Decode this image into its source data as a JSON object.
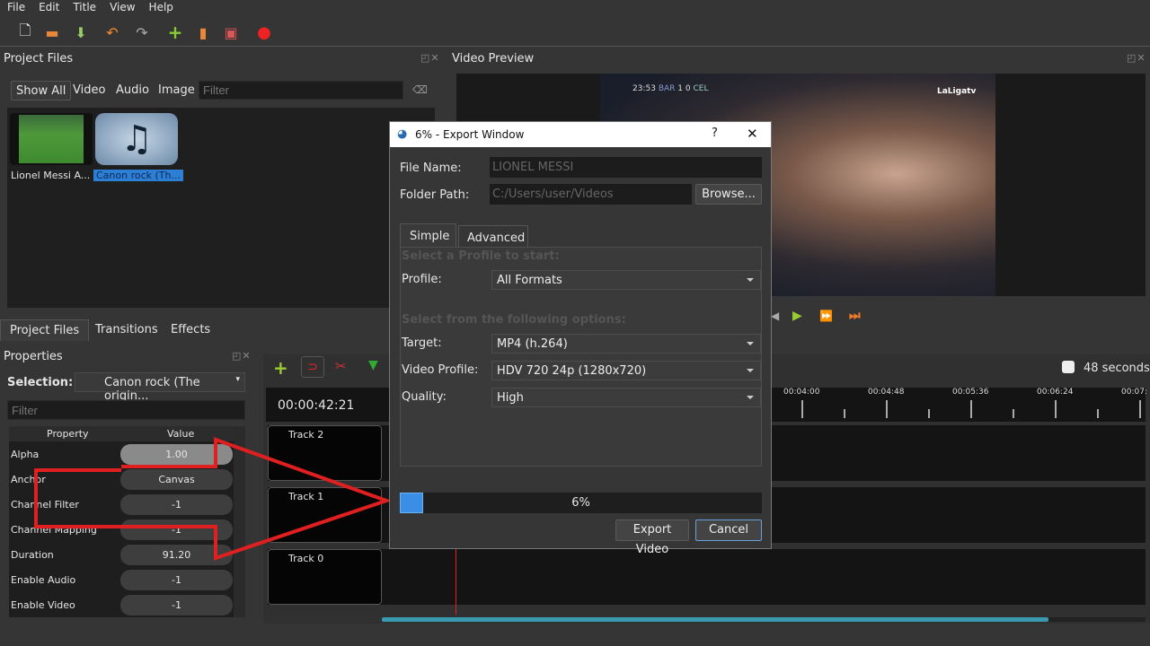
{
  "menu": [
    "File",
    "Edit",
    "Title",
    "View",
    "Help"
  ],
  "toolbar": {
    "icons": [
      "new-project-icon",
      "open-project-icon",
      "save-project-icon",
      "undo-icon",
      "redo-icon",
      "import-files-icon",
      "profile-icon",
      "fullscreen-icon",
      "export-icon"
    ]
  },
  "project_files": {
    "title": "Project Files",
    "filters": [
      "Show All",
      "Video",
      "Audio",
      "Image"
    ],
    "filter_placeholder": "Filter",
    "items": [
      {
        "name": "Lionel Messi A...",
        "type": "video"
      },
      {
        "name": "Canon rock (Th...",
        "type": "audio",
        "selected": true
      }
    ]
  },
  "video_preview": {
    "title": "Video Preview",
    "scoreboard": {
      "time": "23:53",
      "home": "BAR",
      "home_score": "1",
      "away_score": "0",
      "away": "CEL"
    },
    "watermark": "LaLigatv"
  },
  "bottom_tabs": [
    "Project Files",
    "Transitions",
    "Effects"
  ],
  "properties": {
    "title": "Properties",
    "selection_label": "Selection:",
    "selection_value": "Canon rock (The origin...",
    "filter_placeholder": "Filter",
    "columns": [
      "Property",
      "Value"
    ],
    "rows": [
      {
        "k": "Alpha",
        "v": "1.00"
      },
      {
        "k": "Anchor",
        "v": "Canvas"
      },
      {
        "k": "Channel Filter",
        "v": "-1"
      },
      {
        "k": "Channel Mapping",
        "v": "-1"
      },
      {
        "k": "Duration",
        "v": "91.20"
      },
      {
        "k": "Enable Audio",
        "v": "-1"
      },
      {
        "k": "Enable Video",
        "v": "-1"
      }
    ]
  },
  "timeline": {
    "current_time": "00:00:42:21",
    "zoom_label": "48 seconds",
    "ruler": [
      "00:04:00",
      "00:04:48",
      "00:05:36",
      "00:06:24",
      "00:07:"
    ],
    "tracks": [
      "Track 2",
      "Track 1",
      "Track 0"
    ]
  },
  "export": {
    "title": "6% - Export Window",
    "help": "?",
    "file_name_label": "File Name:",
    "file_name": "LIONEL MESSI",
    "folder_label": "Folder Path:",
    "folder": "C:/Users/user/Videos",
    "browse": "Browse...",
    "tabs": [
      "Simple",
      "Advanced"
    ],
    "section1": "Select a Profile to start:",
    "profile_label": "Profile:",
    "profile": "All Formats",
    "section2": "Select from the following options:",
    "target_label": "Target:",
    "target": "MP4 (h.264)",
    "video_profile_label": "Video Profile:",
    "video_profile": "HDV 720 24p (1280x720)",
    "quality_label": "Quality:",
    "quality": "High",
    "progress_text": "6%",
    "progress": 6,
    "export_button": "Export Video",
    "cancel_button": "Cancel"
  },
  "colors": {
    "accent": "#3a8ee6",
    "annotation": "#e02020",
    "scroll": "#3a9bb0"
  }
}
